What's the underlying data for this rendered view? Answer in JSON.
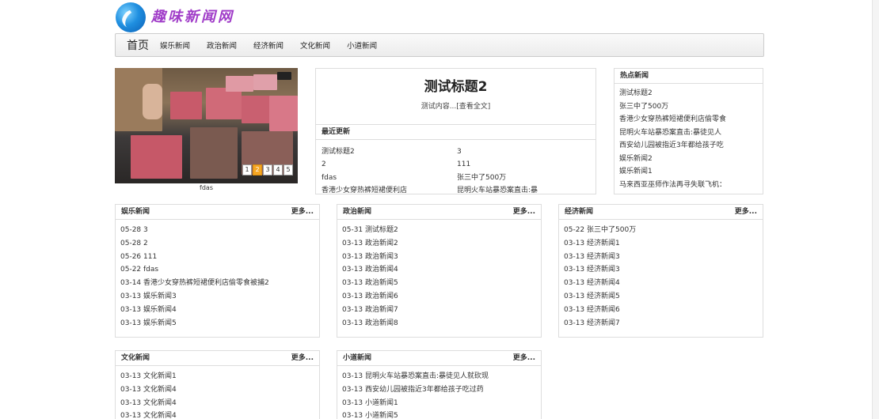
{
  "site": {
    "logo_text": "趣味新闻网"
  },
  "nav": {
    "home": "首页",
    "items": [
      "娱乐新闻",
      "政治新闻",
      "经济新闻",
      "文化新闻",
      "小道新闻"
    ]
  },
  "slider": {
    "caption": "fdas",
    "pages": [
      "1",
      "2",
      "3",
      "4",
      "5"
    ],
    "active_page": "2"
  },
  "feature": {
    "title": "测试标题2",
    "desc": "测试内容...",
    "link": "[查看全文]"
  },
  "recent": {
    "heading": "最近更新",
    "items": [
      "测试标题2",
      "3",
      "2",
      "111",
      "fdas",
      "张三中了500万",
      "香港少女穿热裤短裙便利店",
      "昆明火车站暴恐案直击:暴"
    ]
  },
  "hot": {
    "heading": "热点新闻",
    "items": [
      "测试标题2",
      "张三中了500万",
      "香港少女穿热裤短裙便利店偷零食",
      "昆明火车站暴恐案直击:暴徒见人",
      "西安幼儿园被指近3年都给孩子吃",
      "娱乐新闻2",
      "娱乐新闻1",
      "马来西亚巫师作法再寻失联飞机："
    ]
  },
  "more_label": "更多...",
  "sections": [
    {
      "title": "娱乐新闻",
      "items": [
        "05-28 3",
        "05-28 2",
        "05-26 111",
        "05-22 fdas",
        "03-14 香港少女穿热裤短裙便利店偷零食被捕2",
        "03-13 娱乐新闻3",
        "03-13 娱乐新闻4",
        "03-13 娱乐新闻5"
      ]
    },
    {
      "title": "政治新闻",
      "items": [
        "05-31 测试标题2",
        "03-13 政治新闻2",
        "03-13 政治新闻3",
        "03-13 政治新闻4",
        "03-13 政治新闻5",
        "03-13 政治新闻6",
        "03-13 政治新闻7",
        "03-13 政治新闻8"
      ]
    },
    {
      "title": "经济新闻",
      "items": [
        "05-22 张三中了500万",
        "03-13 经济新闻1",
        "03-13 经济新闻3",
        "03-13 经济新闻3",
        "03-13 经济新闻4",
        "03-13 经济新闻5",
        "03-13 经济新闻6",
        "03-13 经济新闻7"
      ]
    },
    {
      "title": "文化新闻",
      "items": [
        "03-13 文化新闻1",
        "03-13 文化新闻4",
        "03-13 文化新闻4",
        "03-13 文化新闻4"
      ]
    },
    {
      "title": "小道新闻",
      "items": [
        "03-13 昆明火车站暴恐案直击:暴徒见人就砍现",
        "03-13 西安幼儿园被指近3年都给孩子吃过药",
        "03-13 小道新闻1",
        "03-13 小道新闻5"
      ]
    }
  ]
}
